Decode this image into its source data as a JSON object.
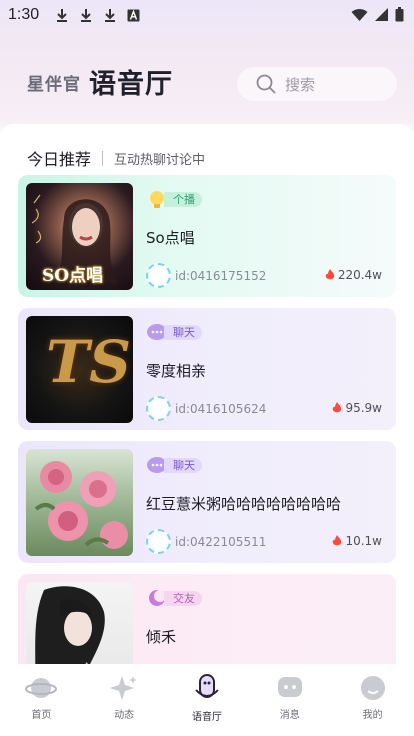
{
  "status_bar": {
    "time": "1:30",
    "left_icons": [
      "download-icon",
      "download-icon",
      "download-icon",
      "font-a-icon"
    ],
    "right_icons": [
      "wifi-icon",
      "signal-icon",
      "battery-icon"
    ]
  },
  "header": {
    "tab_inactive": "星伴官",
    "tab_active": "语音厅",
    "search_placeholder": "搜索"
  },
  "recommend": {
    "title": "今日推荐",
    "subtitle": "互动热聊讨论中"
  },
  "rooms": [
    {
      "tag": "个播",
      "tag_color": "#3bbd8c",
      "name": "So点唱",
      "id": "id:0416175152",
      "heat": "220.4w"
    },
    {
      "tag": "聊天",
      "tag_color": "#8a6ad8",
      "name": "零度相亲",
      "id": "id:0416105624",
      "heat": "95.9w"
    },
    {
      "tag": "聊天",
      "tag_color": "#8a6ad8",
      "name": "红豆薏米粥哈哈哈哈哈哈哈哈",
      "id": "id:0422105511",
      "heat": "10.1w"
    },
    {
      "tag": "交友",
      "tag_color": "#c76ac8",
      "name": "倾禾",
      "id": "",
      "heat": ""
    }
  ],
  "cover_texts": {
    "cover1": "SO点唱",
    "cover2": "TS"
  },
  "tabbar": [
    {
      "label": "首页",
      "icon": "planet-icon"
    },
    {
      "label": "动态",
      "icon": "sparkle-icon"
    },
    {
      "label": "语音厅",
      "icon": "microphone-icon"
    },
    {
      "label": "消息",
      "icon": "chat-bubble-icon"
    },
    {
      "label": "我的",
      "icon": "profile-face-icon"
    }
  ],
  "colors": {
    "accent_active": "#6b3fb8",
    "heat_flame": "#ff4a3d"
  }
}
